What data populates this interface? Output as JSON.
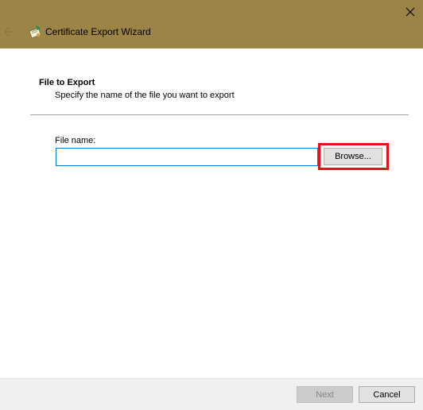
{
  "window": {
    "title": "Certificate Export Wizard",
    "titlebar_color": "#9b8446"
  },
  "icons": {
    "close": "close-icon",
    "back": "back-arrow-icon",
    "app": "certificate-icon"
  },
  "page": {
    "section_title": "File to Export",
    "section_subtitle": "Specify the name of the file you want to export"
  },
  "form": {
    "file_name_label": "File name:",
    "file_name_value": "",
    "browse_label": "Browse..."
  },
  "highlight_color": "#e8101a",
  "footer": {
    "next_label": "Next",
    "next_enabled": false,
    "cancel_label": "Cancel"
  }
}
